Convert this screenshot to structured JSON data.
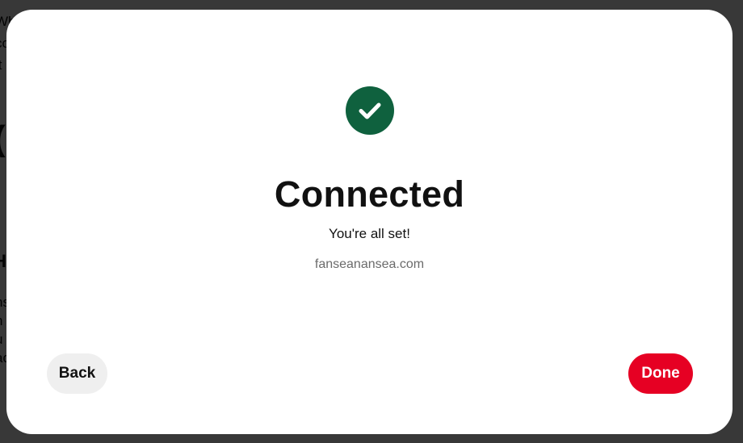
{
  "background": {
    "fragments": [
      "Wh",
      "co",
      "it",
      "(",
      "H",
      "ns",
      "n",
      "u",
      "ac"
    ]
  },
  "dialog": {
    "status_icon": "checkmark-icon",
    "title": "Connected",
    "subtitle": "You're all set!",
    "domain": "fanseanansea.com",
    "back_label": "Back",
    "done_label": "Done"
  },
  "colors": {
    "success": "#0f613e",
    "primary": "#e60023",
    "secondary_button": "#efefef",
    "overlay": "#333333"
  }
}
